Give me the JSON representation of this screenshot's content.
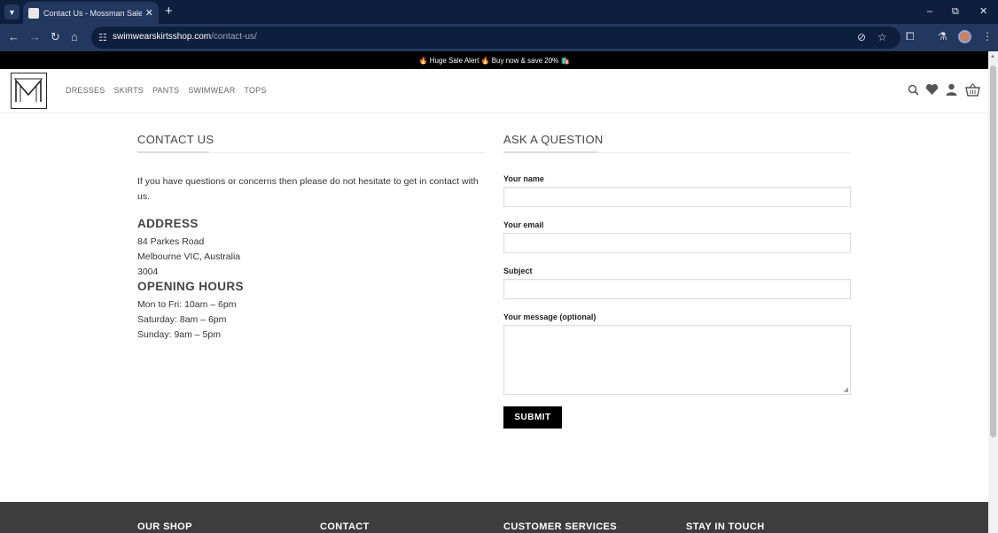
{
  "browser": {
    "tab_title": "Contact Us - Mossman Sales - L",
    "tab_close": "✕",
    "new_tab": "+",
    "url_host": "swimwearskirtsshop.com",
    "url_path": "/contact-us/",
    "window": {
      "minimize": "–",
      "restore": "⧉",
      "close": "✕"
    }
  },
  "site": {
    "announcement": "🔥 Huge Sale Alert 🔥 Buy now & save 20% 🛍️",
    "nav": [
      "DRESSES",
      "SKIRTS",
      "PANTS",
      "SWIMWEAR",
      "TOPS"
    ]
  },
  "contact": {
    "title": "CONTACT US",
    "intro": "If you have questions or concerns then please do not hesitate to get in contact with us.",
    "address_title": "ADDRESS",
    "address_lines": [
      "84 Parkes Road",
      "Melbourne VIC, Australia",
      "3004"
    ],
    "hours_title": "OPENING HOURS",
    "hours_lines": [
      "Mon to Fri: 10am – 6pm",
      "Saturday: 8am – 6pm",
      "Sunday: 9am – 5pm"
    ]
  },
  "form": {
    "title": "ASK A QUESTION",
    "name_label": "Your name",
    "email_label": "Your email",
    "subject_label": "Subject",
    "message_label": "Your message (optional)",
    "submit_label": "SUBMIT"
  },
  "footer": {
    "headings": [
      "OUR SHOP",
      "CONTACT",
      "CUSTOMER SERVICES",
      "STAY IN TOUCH"
    ]
  }
}
